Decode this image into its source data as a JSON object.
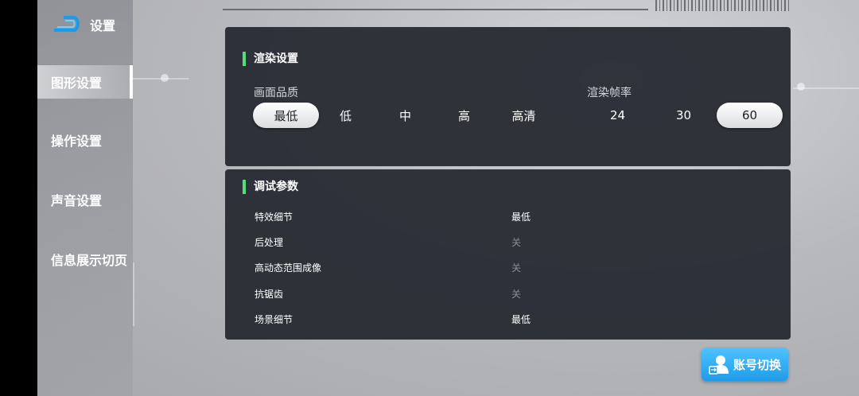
{
  "app": {
    "title": "设置"
  },
  "sidebar": {
    "items": [
      {
        "label": "图形设置",
        "active": true
      },
      {
        "label": "操作设置",
        "active": false
      },
      {
        "label": "声音设置",
        "active": false
      },
      {
        "label": "信息展示切页",
        "active": false
      }
    ]
  },
  "render": {
    "title": "渲染设置",
    "quality": {
      "label": "画面品质",
      "options": [
        "最低",
        "低",
        "中",
        "高",
        "高清"
      ],
      "selected": "最低"
    },
    "framerate": {
      "label": "渲染帧率",
      "options": [
        "24",
        "30",
        "60"
      ],
      "selected": "60"
    }
  },
  "debug": {
    "title": "调试参数",
    "rows": [
      {
        "label": "特效细节",
        "value": "最低"
      },
      {
        "label": "后处理",
        "value": "关"
      },
      {
        "label": "高动态范围成像",
        "value": "关"
      },
      {
        "label": "抗锯齿",
        "value": "关"
      },
      {
        "label": "场景细节",
        "value": "最低"
      }
    ]
  },
  "account": {
    "switch_label": "账号切换"
  },
  "colors": {
    "accent": "#4ee07a",
    "button_blue": "#2aa8f0"
  }
}
